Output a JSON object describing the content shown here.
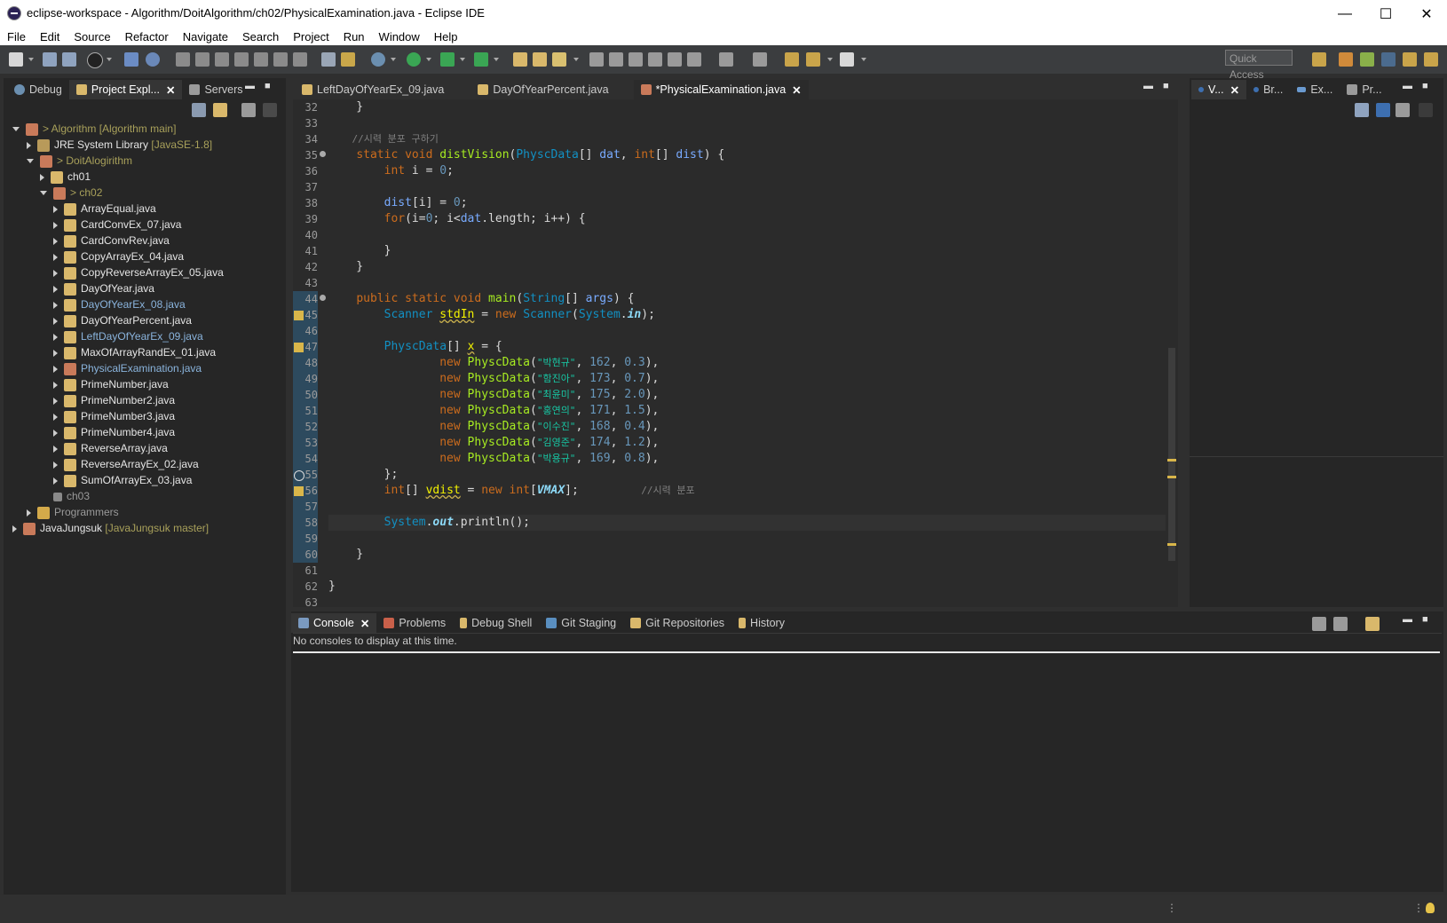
{
  "window": {
    "title": "eclipse-workspace - Algorithm/DoitAlgorithm/ch02/PhysicalExamination.java - Eclipse IDE",
    "minimize": "—",
    "maximize": "☐",
    "close": "✕"
  },
  "menu": [
    "File",
    "Edit",
    "Source",
    "Refactor",
    "Navigate",
    "Search",
    "Project",
    "Run",
    "Window",
    "Help"
  ],
  "toolbar": {
    "quick_access": "Quick Access"
  },
  "left_tabs": [
    {
      "label": "Debug"
    },
    {
      "label": "Project Expl...",
      "close": "✕"
    },
    {
      "label": "Servers"
    }
  ],
  "tree": [
    {
      "label": "> Algorithm",
      "deco": "[Algorithm main]"
    },
    {
      "label": "JRE System Library",
      "deco": "[JavaSE-1.8]"
    },
    {
      "label": "> DoitAlogirithm"
    },
    {
      "label": "ch01"
    },
    {
      "label": "> ch02"
    },
    {
      "label": "ArrayEqual.java"
    },
    {
      "label": "CardConvEx_07.java"
    },
    {
      "label": "CardConvRev.java"
    },
    {
      "label": "CopyArrayEx_04.java"
    },
    {
      "label": "CopyReverseArrayEx_05.java"
    },
    {
      "label": "DayOfYear.java"
    },
    {
      "label": "DayOfYearEx_08.java"
    },
    {
      "label": "DayOfYearPercent.java"
    },
    {
      "label": "LeftDayOfYearEx_09.java"
    },
    {
      "label": "MaxOfArrayRandEx_01.java"
    },
    {
      "label": "PhysicalExamination.java"
    },
    {
      "label": "PrimeNumber.java"
    },
    {
      "label": "PrimeNumber2.java"
    },
    {
      "label": "PrimeNumber3.java"
    },
    {
      "label": "PrimeNumber4.java"
    },
    {
      "label": "ReverseArray.java"
    },
    {
      "label": "ReverseArrayEx_02.java"
    },
    {
      "label": "SumOfArrayEx_03.java"
    },
    {
      "label": "ch03"
    },
    {
      "label": "Programmers"
    },
    {
      "label": "JavaJungsuk",
      "deco": "[JavaJungsuk master]"
    }
  ],
  "editor_tabs": [
    {
      "label": "LeftDayOfYearEx_09.java"
    },
    {
      "label": "DayOfYearPercent.java"
    },
    {
      "label": "*PhysicalExamination.java",
      "close": "✕"
    }
  ],
  "right_tabs": [
    {
      "label": "V...",
      "close": "✕"
    },
    {
      "label": "Br..."
    },
    {
      "label": "Ex..."
    },
    {
      "label": "Pr..."
    }
  ],
  "line_numbers": [
    "32",
    "33",
    "34",
    "35",
    "36",
    "37",
    "38",
    "39",
    "40",
    "41",
    "42",
    "43",
    "44",
    "45",
    "46",
    "47",
    "48",
    "49",
    "50",
    "51",
    "52",
    "53",
    "54",
    "55",
    "56",
    "57",
    "58",
    "59",
    "60",
    "61",
    "62",
    "63"
  ],
  "code": {
    "l32": "    }",
    "l34_comment": "    //시력 분포 구하기",
    "l35_static": "static",
    "l35_void": "void",
    "l35_name": "distVision",
    "l35_type": "PhyscData",
    "l35_rest1": "[] ",
    "l35_dat": "dat",
    "l35_comma": ", ",
    "l35_int": "int",
    "l35_rest2": "[] ",
    "l35_dist": "dist",
    "l35_end": ") {",
    "l36_int": "int",
    "l36_rest": " i = ",
    "l36_zero": "0",
    "l38_dist": "dist",
    "l38_rest": "[i] = ",
    "l38_zero": "0",
    "l39_for": "for",
    "l39_a": "(i=",
    "l39_zero": "0",
    "l39_b": "; i<",
    "l39_dat": "dat",
    "l39_c": ".length; i++) {",
    "l41": "        }",
    "l42": "    }",
    "l44_public": "public",
    "l44_static": "static",
    "l44_void": "void",
    "l44_main": "main",
    "l44_string": "String",
    "l44_rest": "[] ",
    "l44_args": "args",
    "l44_end": ") {",
    "l45_scanner": "Scanner",
    "l45_var": "stdIn",
    "l45_eq": " = ",
    "l45_new": "new",
    "l45_scanner2": "Scanner",
    "l45_p": "(",
    "l45_system": "System",
    "l45_dot": ".",
    "l45_in": "in",
    "l45_end": ");",
    "l47_type": "PhyscData",
    "l47_rest": "[] ",
    "l47_x": "x",
    "l47_end": " = {",
    "rows": [
      {
        "name": "\"박현규\"",
        "h": "162",
        "v": "0.3"
      },
      {
        "name": "\"함진아\"",
        "h": "173",
        "v": "0.7"
      },
      {
        "name": "\"최윤미\"",
        "h": "175",
        "v": "2.0"
      },
      {
        "name": "\"홍연의\"",
        "h": "171",
        "v": "1.5"
      },
      {
        "name": "\"이수진\"",
        "h": "168",
        "v": "0.4"
      },
      {
        "name": "\"김영준\"",
        "h": "174",
        "v": "1.2"
      },
      {
        "name": "\"박용규\"",
        "h": "169",
        "v": "0.8"
      }
    ],
    "row_new": "new",
    "row_ctor": "PhyscData",
    "l55": "        };",
    "l56_int": "int",
    "l56_rest": "[] ",
    "l56_var": "vdist",
    "l56_eq": " = ",
    "l56_new": "new",
    "l56_int2": "int",
    "l56_b": "[",
    "l56_vmax": "VMAX",
    "l56_e": "];",
    "l56_comment": "//시력 분포",
    "l58_system": "System",
    "l58_dot": ".",
    "l58_out": "out",
    "l58_rest": ".println();",
    "l60": "    }",
    "l62": "}"
  },
  "console_tabs": [
    {
      "label": "Console",
      "close": "✕"
    },
    {
      "label": "Problems"
    },
    {
      "label": "Debug Shell"
    },
    {
      "label": "Git Staging"
    },
    {
      "label": "Git Repositories"
    },
    {
      "label": "History"
    }
  ],
  "console": {
    "message": "No consoles to display at this time."
  },
  "colors": {
    "accent": "#1290c3",
    "keyword": "#cc6c1d",
    "string": "#17c6a3",
    "method": "#a7ec21"
  }
}
